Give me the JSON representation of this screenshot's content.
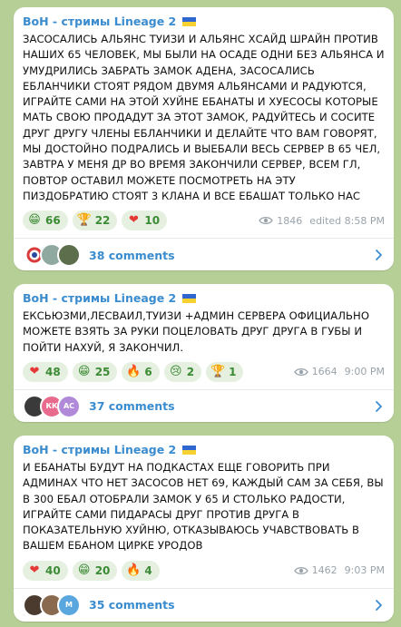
{
  "posts": [
    {
      "channel": "BoH - стримы Lineage 2",
      "text": "ЗАСОСАЛИСЬ АЛЬЯНС ТУИЗИ И АЛЬЯНС ХСАЙД ШРАЙН ПРОТИВ НАШИХ 65 ЧЕЛОВЕК, МЫ БЫЛИ НА ОСАДЕ ОДНИ БЕЗ АЛЬЯНСА И УМУДРИЛИСЬ ЗАБРАТЬ ЗАМОК АДЕНА, ЗАСОСАЛИСЬ ЕБЛАНЧИКИ СТОЯТ РЯДОМ ДВУМЯ АЛЬЯНСАМИ И РАДУЮТСЯ, ИГРАЙТЕ САМИ НА ЭТОЙ ХУЙНЕ ЕБАНАТЫ И ХУЕСОСЫ КОТОРЫЕ МАТЬ СВОЮ ПРОДАДУТ ЗА ЭТОТ ЗАМОК, РАДУЙТЕСЬ И СОСИТЕ ДРУГ ДРУГУ ЧЛЕНЫ ЕБЛАНЧИКИ И ДЕЛАЙТЕ ЧТО ВАМ ГОВОРЯТ, МЫ ДОСТОЙНО ПОДРАЛИСЬ И ВЫЕБАЛИ ВЕСЬ СЕРВЕР В 65 ЧЕЛ, ЗАВТРА У МЕНЯ ДР ВО ВРЕМЯ ЗАКОНЧИЛИ СЕРВЕР, ВСЕМ ГЛ, ПОВТОР ОСТАВИЛ МОЖЕТЕ ПОСМОТРЕТЬ НА ЭТУ ПИЗДОБРАТИЮ СТОЯТ 3 КЛАНА И ВСЕ ЕБАШАТ ТОЛЬКО НАС",
      "reactions": [
        {
          "emoji": "😁",
          "count": "66"
        },
        {
          "emoji": "🏆",
          "count": "22"
        },
        {
          "emoji": "❤",
          "count": "10"
        }
      ],
      "views": "1846",
      "time": "edited 8:58 PM",
      "comments_label": "38 comments",
      "avatars": [
        {
          "text": "",
          "color": "#d93a3a",
          "icon": "ring-logo-avatar"
        },
        {
          "text": "",
          "color": "#8fa8a0",
          "icon": "photo-avatar"
        },
        {
          "text": "",
          "color": "#5c6e4c",
          "icon": "photo-avatar"
        }
      ]
    },
    {
      "channel": "BoH - стримы Lineage 2",
      "text": "ЕКСЬЮЗМИ,ЛЕСВАИЛ,ТУИЗИ +АДМИН СЕРВЕРА ОФИЦИАЛЬНО МОЖЕТЕ ВЗЯТЬ ЗА РУКИ ПОЦЕЛОВАТЬ ДРУГ ДРУГА В ГУБЫ И ПОЙТИ НАХУЙ, Я ЗАКОНЧИЛ.",
      "reactions": [
        {
          "emoji": "❤",
          "count": "48"
        },
        {
          "emoji": "😁",
          "count": "25"
        },
        {
          "emoji": "🔥",
          "count": "6"
        },
        {
          "emoji": "😢",
          "count": "2"
        },
        {
          "emoji": "🏆",
          "count": "1"
        }
      ],
      "views": "1664",
      "time": "9:00 PM",
      "comments_label": "37 comments",
      "avatars": [
        {
          "text": "",
          "color": "#3a3a3a",
          "icon": "photo-avatar"
        },
        {
          "text": "КК",
          "color": "#e86a8c",
          "icon": "initials-avatar"
        },
        {
          "text": "AC",
          "color": "#b08ad8",
          "icon": "initials-avatar"
        }
      ]
    },
    {
      "channel": "BoH - стримы Lineage 2",
      "text": "И ЕБАНАТЫ БУДУТ НА ПОДКАСТАХ ЕЩЕ ГОВОРИТЬ ПРИ АДМИНАХ ЧТО НЕТ ЗАСОСОВ НЕТ 69, КАЖДЫЙ САМ ЗА СЕБЯ, ВЫ В 300 ЕБАЛ ОТОБРАЛИ ЗАМОК У 65 И СТОЛЬКО РАДОСТИ, ИГРАЙТЕ САМИ ПИДАРАСЫ ДРУГ ПРОТИВ ДРУГА В ПОКАЗАТЕЛЬНУЮ ХУЙНЮ, ОТКАЗЫВАЮСЬ УЧАВСТВОВАТЬ В ВАШЕМ ЕБАНОМ ЦИРКЕ УРОДОВ",
      "reactions": [
        {
          "emoji": "❤",
          "count": "40"
        },
        {
          "emoji": "😁",
          "count": "20"
        },
        {
          "emoji": "🔥",
          "count": "4"
        }
      ],
      "views": "1462",
      "time": "9:03 PM",
      "comments_label": "35 comments",
      "avatars": [
        {
          "text": "",
          "color": "#4a3b2e",
          "icon": "photo-avatar"
        },
        {
          "text": "",
          "color": "#8a6a4e",
          "icon": "photo-avatar"
        },
        {
          "text": "M",
          "color": "#5aa7e0",
          "icon": "initials-avatar"
        }
      ]
    }
  ],
  "colors": {
    "background": "#b6cf96",
    "accent": "#3a8ccf",
    "reaction_text": "#3b8a34",
    "reaction_bg": "#e5f0e0",
    "heart": "#e53935"
  }
}
